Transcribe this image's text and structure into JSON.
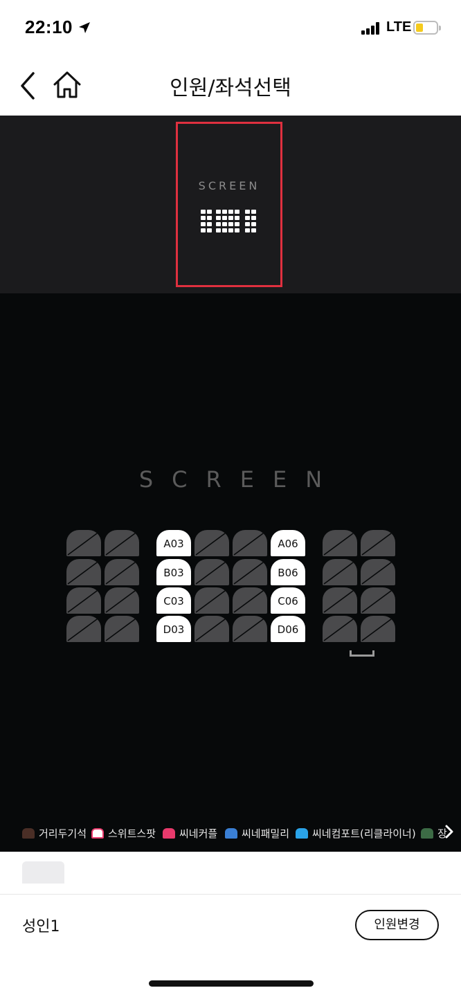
{
  "status_bar": {
    "time": "22:10",
    "network": "LTE",
    "icons": [
      "location-arrow-icon",
      "signal-icon",
      "battery-icon"
    ]
  },
  "nav": {
    "title": "인원/좌석선택",
    "icons": [
      "chevron-left-icon",
      "home-icon"
    ]
  },
  "minimap": {
    "screen_label": "SCREEN",
    "frame_color": "#e0303f"
  },
  "seatmap": {
    "screen_label": "SCREEN",
    "rows": [
      "A",
      "B",
      "C",
      "D"
    ],
    "available_seats": [
      {
        "label": "A03"
      },
      {
        "label": "A06"
      },
      {
        "label": "B03"
      },
      {
        "label": "B06"
      },
      {
        "label": "C03"
      },
      {
        "label": "C06"
      },
      {
        "label": "D03"
      },
      {
        "label": "D06"
      }
    ],
    "seat_colors": {
      "disabled": "#4a4a4c",
      "available": "#ffffff",
      "background": "#07090a"
    }
  },
  "legend": {
    "items": [
      {
        "label": "거리두기석",
        "color": "#4a2e26"
      },
      {
        "label": "스위트스팟",
        "color": "#ffffff"
      },
      {
        "label": "씨네커플",
        "color": "#e83a6c"
      },
      {
        "label": "씨네패밀리",
        "color": "#3a7fd4"
      },
      {
        "label": "씨네컴포트(리클라이너)",
        "color": "#2aa3e8"
      },
      {
        "label": "장",
        "color": "#3c6b45"
      }
    ],
    "next_icon": "chevron-right-icon"
  },
  "bottom": {
    "person_label": "성인1",
    "change_button": "인원변경"
  }
}
